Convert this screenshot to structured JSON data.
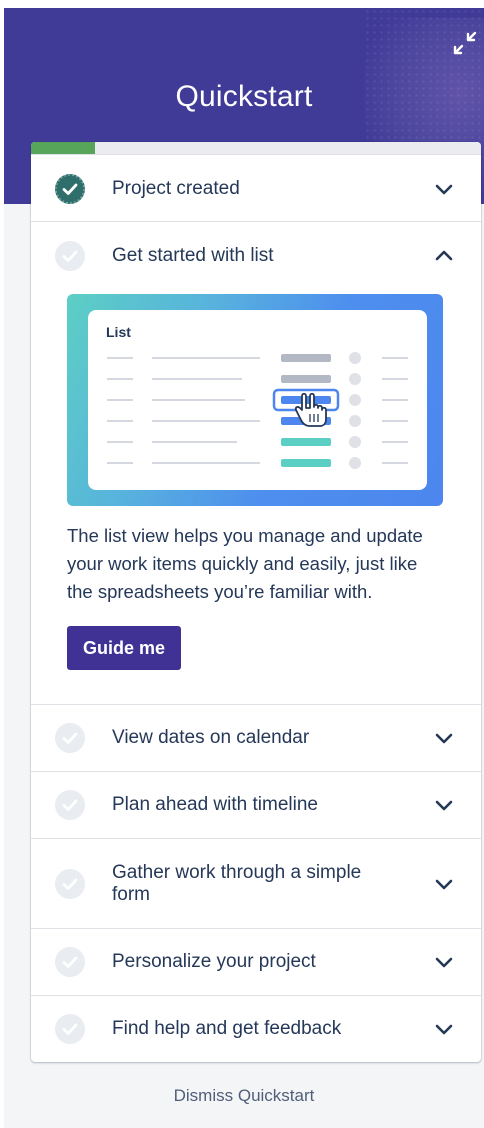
{
  "header": {
    "title": "Quickstart",
    "collapse_icon": "collapse-arrows-icon",
    "background_color": "#413b98"
  },
  "progress": {
    "completed_fraction": 0.143
  },
  "tasks": [
    {
      "label": "Project created",
      "status": "done",
      "expanded": false
    },
    {
      "label": "Get started with list",
      "status": "todo",
      "expanded": true,
      "illustration_title": "List",
      "description": "The list view helps you manage and update your work items quickly and easily, just like the spreadsheets you’re familiar with.",
      "button_label": "Guide me"
    },
    {
      "label": "View dates on calendar",
      "status": "todo",
      "expanded": false
    },
    {
      "label": "Plan ahead with timeline",
      "status": "todo",
      "expanded": false
    },
    {
      "label": "Gather work through a simple form",
      "status": "todo",
      "expanded": false
    },
    {
      "label": "Personalize your project",
      "status": "todo",
      "expanded": false
    },
    {
      "label": "Find help and get feedback",
      "status": "todo",
      "expanded": false
    }
  ],
  "footer": {
    "dismiss_label": "Dismiss Quickstart"
  },
  "colors": {
    "accent": "#403294",
    "done": "#2f6e6a",
    "progress": "#57a55a"
  }
}
